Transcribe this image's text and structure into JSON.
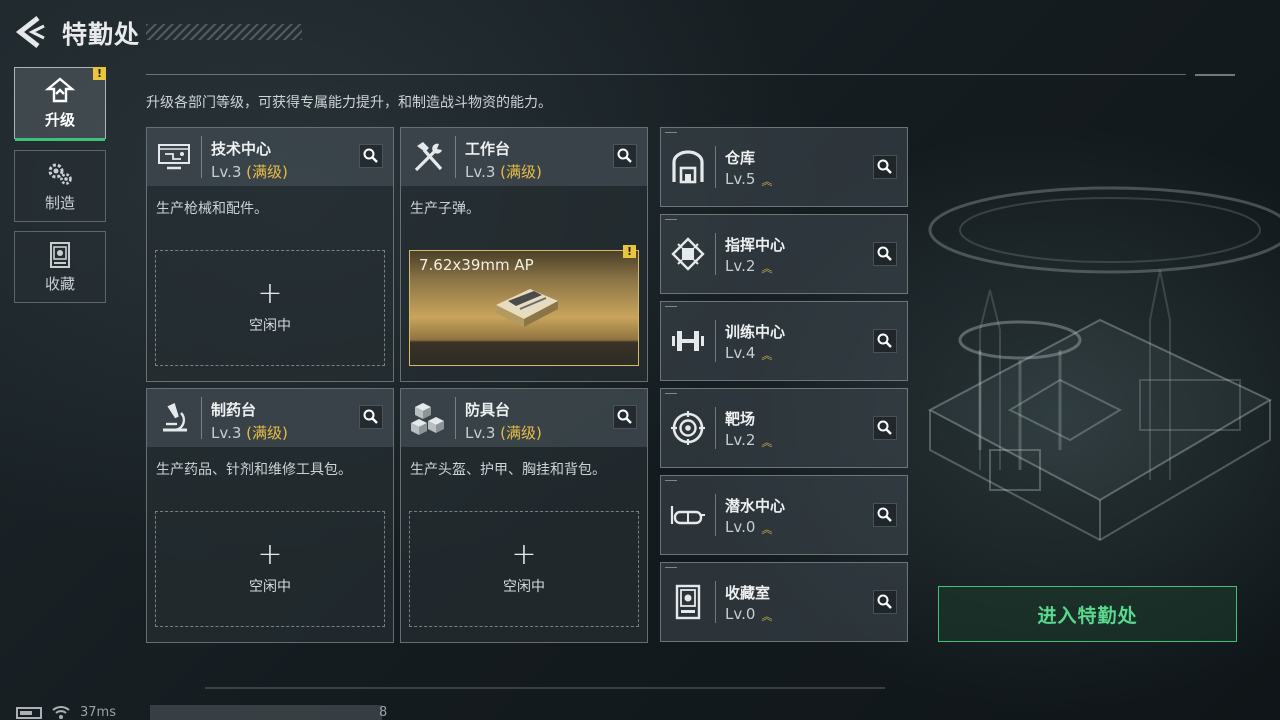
{
  "header": {
    "title": "特勤处",
    "subtitle": "升级各部门等级，可获得专属能力提升，和制造战斗物资的能力。"
  },
  "nav": {
    "items": [
      {
        "label": "升级",
        "icon": "upgrade-icon",
        "active": true,
        "alert": "!"
      },
      {
        "label": "制造",
        "icon": "gears-icon",
        "active": false
      },
      {
        "label": "收藏",
        "icon": "collection-icon",
        "active": false
      }
    ]
  },
  "workshops": [
    {
      "name": "技术中心",
      "level": "Lv.3",
      "max": "(满级)",
      "desc": "生产枪械和配件。",
      "slot": {
        "plus": "+",
        "text": "空闲中"
      },
      "icon": "tech-center-icon"
    },
    {
      "name": "工作台",
      "level": "Lv.3",
      "max": "(满级)",
      "desc": "生产子弹。",
      "product": {
        "name": "7.62x39mm AP",
        "alert": "!"
      },
      "icon": "hammer-wrench-icon"
    },
    {
      "name": "制药台",
      "level": "Lv.3",
      "max": "(满级)",
      "desc": "生产药品、针剂和维修工具包。",
      "slot": {
        "plus": "+",
        "text": "空闲中"
      },
      "icon": "microscope-icon"
    },
    {
      "name": "防具台",
      "level": "Lv.3",
      "max": "(满级)",
      "desc": "生产头盔、护甲、胸挂和背包。",
      "slot": {
        "plus": "+",
        "text": "空闲中"
      },
      "icon": "armor-cubes-icon"
    }
  ],
  "facilities": [
    {
      "name": "仓库",
      "level": "Lv.5",
      "icon": "warehouse-icon"
    },
    {
      "name": "指挥中心",
      "level": "Lv.2",
      "icon": "chip-icon"
    },
    {
      "name": "训练中心",
      "level": "Lv.4",
      "icon": "dumbbell-icon"
    },
    {
      "name": "靶场",
      "level": "Lv.2",
      "icon": "target-icon"
    },
    {
      "name": "潜水中心",
      "level": "Lv.0",
      "icon": "goggles-icon"
    },
    {
      "name": "收藏室",
      "level": "Lv.0",
      "icon": "collection-room-icon"
    }
  ],
  "upgrade_chevron": "︽",
  "enter_button": "进入特勤处",
  "status": {
    "ping": "37ms",
    "chat_count": "8"
  },
  "colors": {
    "accent_green": "#3ec27a",
    "max_level_gold": "#e9bd45",
    "alert_yellow": "#e9c53e"
  }
}
